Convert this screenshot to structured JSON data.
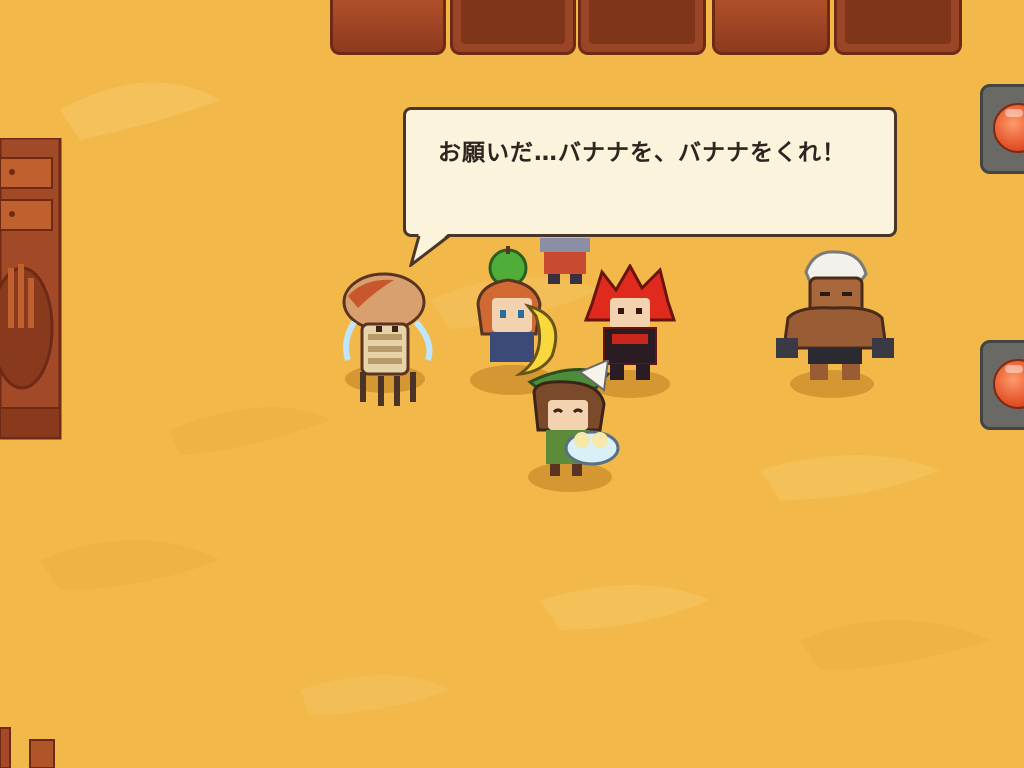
{
  "dialog": {
    "text": "お願いだ…バナナを、バナナをくれ！"
  },
  "colors": {
    "sand": "#f2b84a",
    "dialog_bg": "#fbf3dc",
    "dialog_border": "#4a3628",
    "button_red": "#e5532a"
  },
  "icons": {
    "right_upper_button": "red-round-button-icon",
    "right_lower_button": "red-round-button-icon"
  },
  "characters": [
    "crying-spider-creature",
    "ranger-girl-holding-banana",
    "red-haired-warrior",
    "green-hat-girl-with-chicks",
    "white-haired-brute",
    "back-row-character"
  ]
}
